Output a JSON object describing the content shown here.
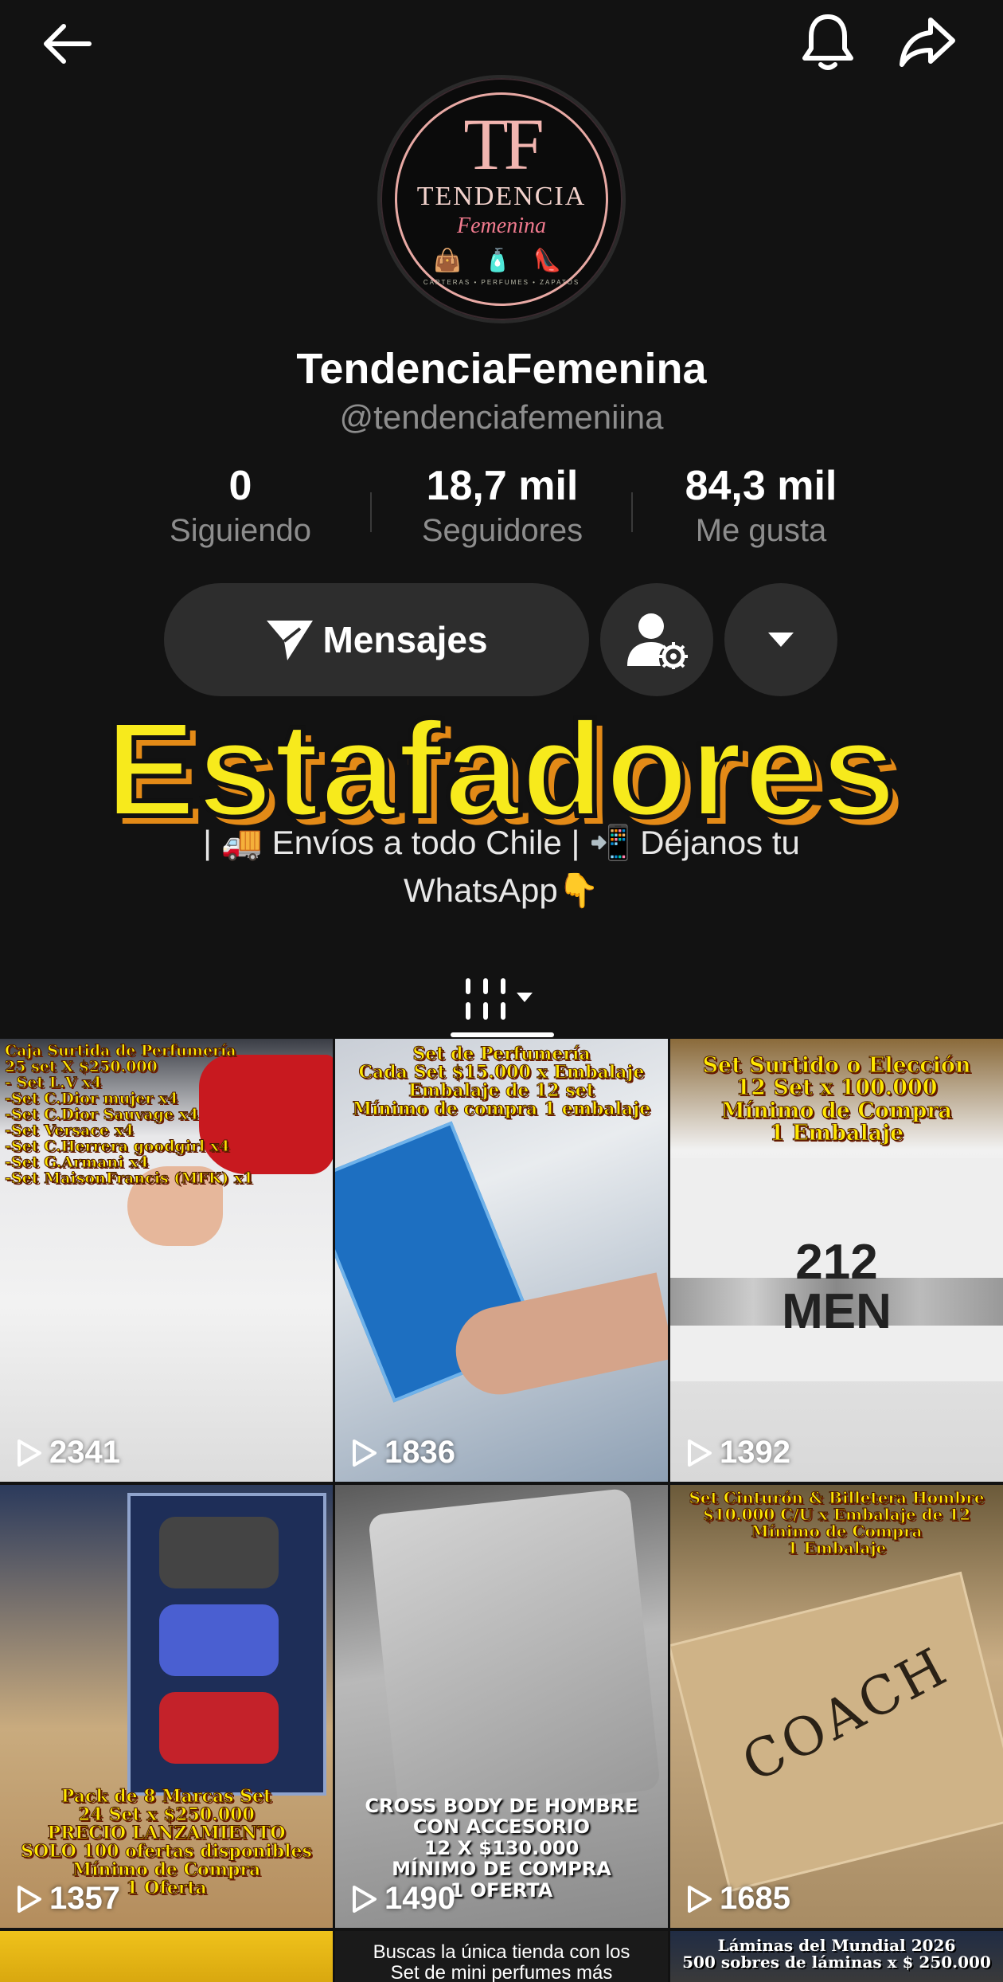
{
  "profile": {
    "logo": {
      "monogram": "TF",
      "name": "TENDENCIA",
      "subname": "Femenina",
      "tagline": "CARTERAS • PERFUMES • ZAPATOS"
    },
    "display_name": "TendenciaFemenina",
    "handle": "@tendenciafemeniina"
  },
  "stats": [
    {
      "value": "0",
      "label": "Siguiendo"
    },
    {
      "value": "18,7 mil",
      "label": "Seguidores"
    },
    {
      "value": "84,3 mil",
      "label": "Me gusta"
    }
  ],
  "actions": {
    "message_label": "Mensajes"
  },
  "bio": {
    "line3": "| 🚚 Envíos a todo Chile | 📲 Déjanos tu",
    "line4": "WhatsApp👇"
  },
  "overlay_text": "Estafadores",
  "videos": [
    {
      "caption": "Caja Surtida de Perfumería\n25 set X $250.000\n- Set L.V x4\n-Set C.Dior mujer x4\n-Set C.Dior Sauvage x4\n-Set Versace x4\n-Set C.Herrera goodgirl x4\n-Set G.Armani x4\n-Set MaisonFrancis (MFK) x1",
      "views": "2341"
    },
    {
      "caption": "Set de Perfumería\nCada Set $15.000 x Embalaje\nEmbalaje de 12 set\nMínimo de compra 1 embalaje",
      "views": "1836"
    },
    {
      "caption": "Set Surtido o Elección\n12 Set x 100.000\nMínimo de Compra\n1 Embalaje",
      "views": "1392",
      "product_text": "212\nMEN"
    },
    {
      "caption": "Pack de 8 Marcas Set\n24 Set x $250.000\nPRECIO LANZAMIENTO\nSOLO 100 ofertas disponibles\nMínimo de Compra\n1 Oferta",
      "views": "1357"
    },
    {
      "caption": "CROSS BODY DE HOMBRE\nCON ACCESORIO\n12 X $130.000\nMÍNIMO DE COMPRA\n1 OFERTA",
      "views": "1490"
    },
    {
      "caption": "Set Cinturón & Billetera Hombre\n$10.000 C/U x Embalaje de 12\nMínimo de Compra\n1 Embalaje",
      "views": "1685",
      "product_text": "COACH"
    },
    {
      "caption": "",
      "views": ""
    },
    {
      "caption": "Buscas la única tienda con los\nSet de mini perfumes más",
      "views": ""
    },
    {
      "caption": "Láminas del Mundial 2026\n500 sobres de láminas x $ 250.000",
      "views": ""
    }
  ],
  "colors": {
    "background": "#121212",
    "button": "#2d2d2d",
    "muted_text": "#8d8d8d",
    "overlay_fill": "#f7ea1c",
    "overlay_shadow": "#e38a17"
  }
}
